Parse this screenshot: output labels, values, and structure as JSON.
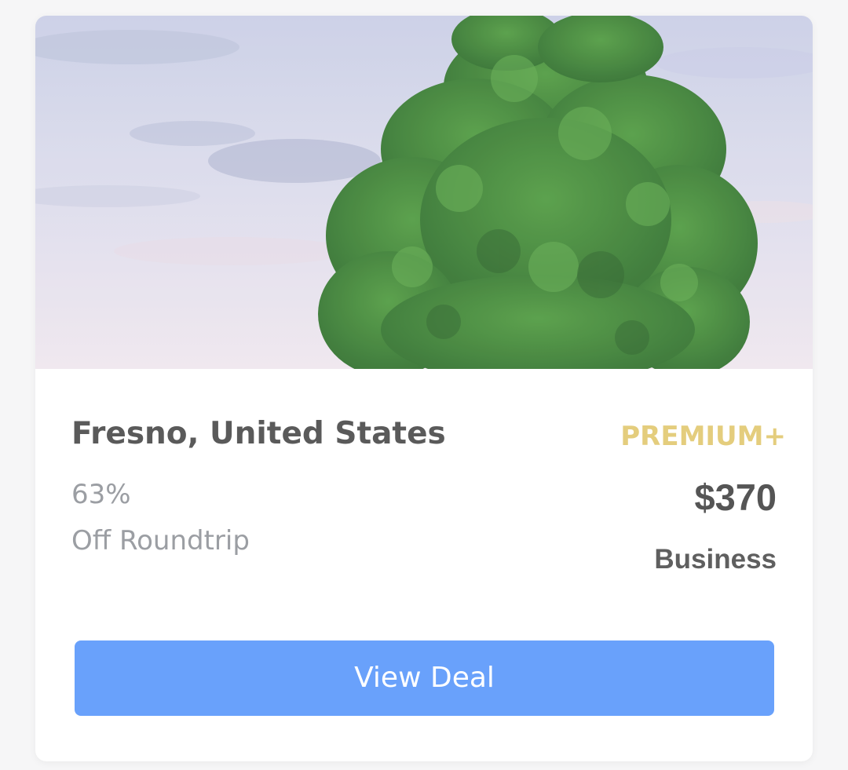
{
  "deal": {
    "destination": "Fresno, United States",
    "discount": "63%",
    "trip_type": "Off Roundtrip",
    "tier": "PREMIUM+",
    "price": "$370",
    "cabin": "Business",
    "cta_label": "View Deal"
  },
  "colors": {
    "tier_gold": "#e4cd7d",
    "button_blue": "#69a1fb",
    "title_gray": "#5a5a5a",
    "muted_gray": "#9b9ea3"
  }
}
